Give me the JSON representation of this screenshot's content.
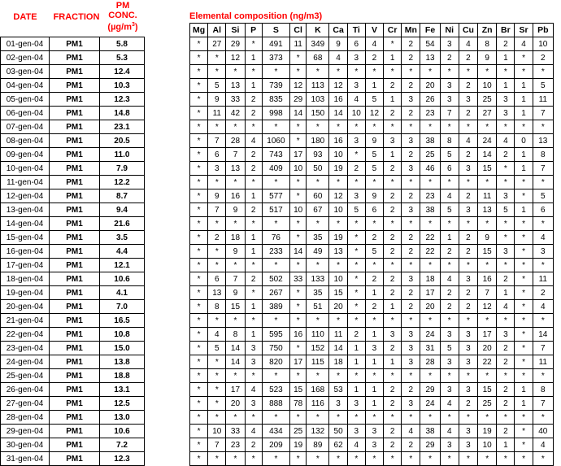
{
  "headers": {
    "date": "DATE",
    "fraction": "FRACTION",
    "pm_line1": "PM",
    "pm_line2": "CONC.",
    "pm_unit": "(µg/m",
    "pm_unit_sup": "3",
    "pm_unit_close": ")",
    "elemental_title": "Elemental composition (ng/m3)"
  },
  "elements": [
    "Mg",
    "Al",
    "Si",
    "P",
    "S",
    "Cl",
    "K",
    "Ca",
    "Ti",
    "V",
    "Cr",
    "Mn",
    "Fe",
    "Ni",
    "Cu",
    "Zn",
    "Br",
    "Sr",
    "Pb"
  ],
  "rows": [
    {
      "date": "01-gen-04",
      "fraction": "PM1",
      "pm": "5.8",
      "values": [
        "*",
        "27",
        "29",
        "*",
        "491",
        "11",
        "349",
        "9",
        "6",
        "4",
        "*",
        "2",
        "54",
        "3",
        "4",
        "8",
        "2",
        "4",
        "10"
      ]
    },
    {
      "date": "02-gen-04",
      "fraction": "PM1",
      "pm": "5.3",
      "values": [
        "*",
        "*",
        "12",
        "1",
        "373",
        "*",
        "68",
        "4",
        "3",
        "2",
        "1",
        "2",
        "13",
        "2",
        "2",
        "9",
        "1",
        "*",
        "2"
      ]
    },
    {
      "date": "03-gen-04",
      "fraction": "PM1",
      "pm": "12.4",
      "values": [
        "*",
        "*",
        "*",
        "*",
        "*",
        "*",
        "*",
        "*",
        "*",
        "*",
        "*",
        "*",
        "*",
        "*",
        "*",
        "*",
        "*",
        "*",
        "*"
      ]
    },
    {
      "date": "04-gen-04",
      "fraction": "PM1",
      "pm": "10.3",
      "values": [
        "*",
        "5",
        "13",
        "1",
        "739",
        "12",
        "113",
        "12",
        "3",
        "1",
        "2",
        "2",
        "20",
        "3",
        "2",
        "10",
        "1",
        "1",
        "5"
      ]
    },
    {
      "date": "05-gen-04",
      "fraction": "PM1",
      "pm": "12.3",
      "values": [
        "*",
        "9",
        "33",
        "2",
        "835",
        "29",
        "103",
        "16",
        "4",
        "5",
        "1",
        "3",
        "26",
        "3",
        "3",
        "25",
        "3",
        "1",
        "11"
      ]
    },
    {
      "date": "06-gen-04",
      "fraction": "PM1",
      "pm": "14.8",
      "values": [
        "*",
        "11",
        "42",
        "2",
        "998",
        "14",
        "150",
        "14",
        "10",
        "12",
        "2",
        "2",
        "23",
        "7",
        "2",
        "27",
        "3",
        "1",
        "7"
      ]
    },
    {
      "date": "07-gen-04",
      "fraction": "PM1",
      "pm": "23.1",
      "values": [
        "*",
        "*",
        "*",
        "*",
        "*",
        "*",
        "*",
        "*",
        "*",
        "*",
        "*",
        "*",
        "*",
        "*",
        "*",
        "*",
        "*",
        "*",
        "*"
      ]
    },
    {
      "date": "08-gen-04",
      "fraction": "PM1",
      "pm": "20.5",
      "values": [
        "*",
        "7",
        "28",
        "4",
        "1060",
        "*",
        "180",
        "16",
        "3",
        "9",
        "3",
        "3",
        "38",
        "8",
        "4",
        "24",
        "4",
        "0",
        "13"
      ]
    },
    {
      "date": "09-gen-04",
      "fraction": "PM1",
      "pm": "11.0",
      "values": [
        "*",
        "6",
        "7",
        "2",
        "743",
        "17",
        "93",
        "10",
        "*",
        "5",
        "1",
        "2",
        "25",
        "5",
        "2",
        "14",
        "2",
        "1",
        "8"
      ]
    },
    {
      "date": "10-gen-04",
      "fraction": "PM1",
      "pm": "7.9",
      "values": [
        "*",
        "3",
        "13",
        "2",
        "409",
        "10",
        "50",
        "19",
        "2",
        "5",
        "2",
        "3",
        "46",
        "6",
        "3",
        "15",
        "*",
        "1",
        "7"
      ]
    },
    {
      "date": "11-gen-04",
      "fraction": "PM1",
      "pm": "12.2",
      "values": [
        "*",
        "*",
        "*",
        "*",
        "*",
        "*",
        "*",
        "*",
        "*",
        "*",
        "*",
        "*",
        "*",
        "*",
        "*",
        "*",
        "*",
        "*",
        "*"
      ]
    },
    {
      "date": "12-gen-04",
      "fraction": "PM1",
      "pm": "8.7",
      "values": [
        "*",
        "9",
        "16",
        "1",
        "577",
        "*",
        "60",
        "12",
        "3",
        "9",
        "2",
        "2",
        "23",
        "4",
        "2",
        "11",
        "3",
        "*",
        "5"
      ]
    },
    {
      "date": "13-gen-04",
      "fraction": "PM1",
      "pm": "9.4",
      "values": [
        "*",
        "7",
        "9",
        "2",
        "517",
        "10",
        "67",
        "10",
        "5",
        "6",
        "2",
        "3",
        "38",
        "5",
        "3",
        "13",
        "5",
        "1",
        "6"
      ]
    },
    {
      "date": "14-gen-04",
      "fraction": "PM1",
      "pm": "21.6",
      "values": [
        "*",
        "*",
        "*",
        "*",
        "*",
        "*",
        "*",
        "*",
        "*",
        "*",
        "*",
        "*",
        "*",
        "*",
        "*",
        "*",
        "*",
        "*",
        "*"
      ]
    },
    {
      "date": "15-gen-04",
      "fraction": "PM1",
      "pm": "3.5",
      "values": [
        "*",
        "2",
        "18",
        "1",
        "76",
        "*",
        "35",
        "19",
        "*",
        "2",
        "2",
        "2",
        "22",
        "1",
        "2",
        "9",
        "*",
        "*",
        "4"
      ]
    },
    {
      "date": "16-gen-04",
      "fraction": "PM1",
      "pm": "4.4",
      "values": [
        "*",
        "*",
        "9",
        "1",
        "233",
        "14",
        "49",
        "13",
        "*",
        "5",
        "2",
        "2",
        "22",
        "2",
        "2",
        "15",
        "3",
        "*",
        "3"
      ]
    },
    {
      "date": "17-gen-04",
      "fraction": "PM1",
      "pm": "12.1",
      "values": [
        "*",
        "*",
        "*",
        "*",
        "*",
        "*",
        "*",
        "*",
        "*",
        "*",
        "*",
        "*",
        "*",
        "*",
        "*",
        "*",
        "*",
        "*",
        "*"
      ]
    },
    {
      "date": "18-gen-04",
      "fraction": "PM1",
      "pm": "10.6",
      "values": [
        "*",
        "6",
        "7",
        "2",
        "502",
        "33",
        "133",
        "10",
        "*",
        "2",
        "2",
        "3",
        "18",
        "4",
        "3",
        "16",
        "2",
        "*",
        "11"
      ]
    },
    {
      "date": "19-gen-04",
      "fraction": "PM1",
      "pm": "4.1",
      "values": [
        "*",
        "13",
        "9",
        "*",
        "267",
        "*",
        "35",
        "15",
        "*",
        "1",
        "2",
        "2",
        "17",
        "2",
        "2",
        "7",
        "1",
        "*",
        "2"
      ]
    },
    {
      "date": "20-gen-04",
      "fraction": "PM1",
      "pm": "7.0",
      "values": [
        "*",
        "8",
        "15",
        "1",
        "389",
        "*",
        "51",
        "20",
        "*",
        "2",
        "1",
        "2",
        "20",
        "2",
        "2",
        "12",
        "4",
        "*",
        "4"
      ]
    },
    {
      "date": "21-gen-04",
      "fraction": "PM1",
      "pm": "16.5",
      "values": [
        "*",
        "*",
        "*",
        "*",
        "*",
        "*",
        "*",
        "*",
        "*",
        "*",
        "*",
        "*",
        "*",
        "*",
        "*",
        "*",
        "*",
        "*",
        "*"
      ]
    },
    {
      "date": "22-gen-04",
      "fraction": "PM1",
      "pm": "10.8",
      "values": [
        "*",
        "4",
        "8",
        "1",
        "595",
        "16",
        "110",
        "11",
        "2",
        "1",
        "3",
        "3",
        "24",
        "3",
        "3",
        "17",
        "3",
        "*",
        "14"
      ]
    },
    {
      "date": "23-gen-04",
      "fraction": "PM1",
      "pm": "15.0",
      "values": [
        "*",
        "5",
        "14",
        "3",
        "750",
        "*",
        "152",
        "14",
        "1",
        "3",
        "2",
        "3",
        "31",
        "5",
        "3",
        "20",
        "2",
        "*",
        "7"
      ]
    },
    {
      "date": "24-gen-04",
      "fraction": "PM1",
      "pm": "13.8",
      "values": [
        "*",
        "*",
        "14",
        "3",
        "820",
        "17",
        "115",
        "18",
        "1",
        "1",
        "1",
        "3",
        "28",
        "3",
        "3",
        "22",
        "2",
        "*",
        "11"
      ]
    },
    {
      "date": "25-gen-04",
      "fraction": "PM1",
      "pm": "18.8",
      "values": [
        "*",
        "*",
        "*",
        "*",
        "*",
        "*",
        "*",
        "*",
        "*",
        "*",
        "*",
        "*",
        "*",
        "*",
        "*",
        "*",
        "*",
        "*",
        "*"
      ]
    },
    {
      "date": "26-gen-04",
      "fraction": "PM1",
      "pm": "13.1",
      "values": [
        "*",
        "*",
        "17",
        "4",
        "523",
        "15",
        "168",
        "53",
        "1",
        "1",
        "2",
        "2",
        "29",
        "3",
        "3",
        "15",
        "2",
        "1",
        "8"
      ]
    },
    {
      "date": "27-gen-04",
      "fraction": "PM1",
      "pm": "12.5",
      "values": [
        "*",
        "*",
        "20",
        "3",
        "888",
        "78",
        "116",
        "3",
        "3",
        "1",
        "2",
        "3",
        "24",
        "4",
        "2",
        "25",
        "2",
        "1",
        "7"
      ]
    },
    {
      "date": "28-gen-04",
      "fraction": "PM1",
      "pm": "13.0",
      "values": [
        "*",
        "*",
        "*",
        "*",
        "*",
        "*",
        "*",
        "*",
        "*",
        "*",
        "*",
        "*",
        "*",
        "*",
        "*",
        "*",
        "*",
        "*",
        "*"
      ]
    },
    {
      "date": "29-gen-04",
      "fraction": "PM1",
      "pm": "10.6",
      "values": [
        "*",
        "10",
        "33",
        "4",
        "434",
        "25",
        "132",
        "50",
        "3",
        "3",
        "2",
        "4",
        "38",
        "4",
        "3",
        "19",
        "2",
        "*",
        "40"
      ]
    },
    {
      "date": "30-gen-04",
      "fraction": "PM1",
      "pm": "7.2",
      "values": [
        "*",
        "7",
        "23",
        "2",
        "209",
        "19",
        "89",
        "62",
        "4",
        "3",
        "2",
        "2",
        "29",
        "3",
        "3",
        "10",
        "1",
        "*",
        "4"
      ]
    },
    {
      "date": "31-gen-04",
      "fraction": "PM1",
      "pm": "12.3",
      "values": [
        "*",
        "*",
        "*",
        "*",
        "*",
        "*",
        "*",
        "*",
        "*",
        "*",
        "*",
        "*",
        "*",
        "*",
        "*",
        "*",
        "*",
        "*",
        "*"
      ]
    }
  ]
}
